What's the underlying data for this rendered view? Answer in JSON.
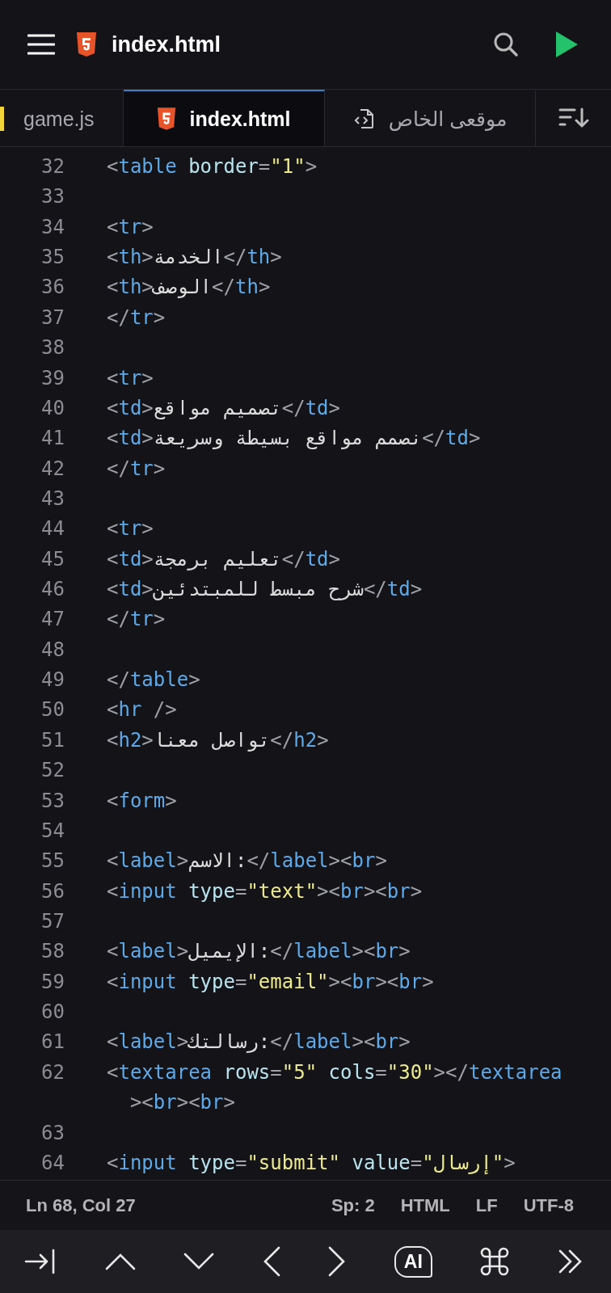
{
  "header": {
    "title": "index.html"
  },
  "tabs": [
    {
      "label": "game.js",
      "kind": "js",
      "selected": false
    },
    {
      "label": "index.html",
      "kind": "html",
      "selected": true
    },
    {
      "label": "موقعى الخاص",
      "kind": "file",
      "selected": false
    }
  ],
  "lines": [
    {
      "number": "32",
      "tokens": [
        {
          "kind": "punct",
          "text": "<"
        },
        {
          "kind": "tag",
          "text": "table"
        },
        {
          "kind": "attr",
          "text": " border"
        },
        {
          "kind": "punct",
          "text": "="
        },
        {
          "kind": "string",
          "text": "\"1\""
        },
        {
          "kind": "punct",
          "text": ">"
        }
      ]
    },
    {
      "number": "33"
    },
    {
      "number": "34",
      "tokens": [
        {
          "kind": "punct",
          "text": "<"
        },
        {
          "kind": "tag",
          "text": "tr"
        },
        {
          "kind": "punct",
          "text": ">"
        }
      ]
    },
    {
      "number": "35",
      "tokens": [
        {
          "kind": "punct",
          "text": "<"
        },
        {
          "kind": "tag",
          "text": "th"
        },
        {
          "kind": "punct",
          "text": ">"
        },
        {
          "kind": "text",
          "text": "الخدمة"
        },
        {
          "kind": "punct",
          "text": "</"
        },
        {
          "kind": "tag",
          "text": "th"
        },
        {
          "kind": "punct",
          "text": ">"
        }
      ]
    },
    {
      "number": "36",
      "tokens": [
        {
          "kind": "punct",
          "text": "<"
        },
        {
          "kind": "tag",
          "text": "th"
        },
        {
          "kind": "punct",
          "text": ">"
        },
        {
          "kind": "text",
          "text": "الوصف"
        },
        {
          "kind": "punct",
          "text": "</"
        },
        {
          "kind": "tag",
          "text": "th"
        },
        {
          "kind": "punct",
          "text": ">"
        }
      ]
    },
    {
      "number": "37",
      "tokens": [
        {
          "kind": "punct",
          "text": "</"
        },
        {
          "kind": "tag",
          "text": "tr"
        },
        {
          "kind": "punct",
          "text": ">"
        }
      ]
    },
    {
      "number": "38"
    },
    {
      "number": "39",
      "tokens": [
        {
          "kind": "punct",
          "text": "<"
        },
        {
          "kind": "tag",
          "text": "tr"
        },
        {
          "kind": "punct",
          "text": ">"
        }
      ]
    },
    {
      "number": "40",
      "tokens": [
        {
          "kind": "punct",
          "text": "<"
        },
        {
          "kind": "tag",
          "text": "td"
        },
        {
          "kind": "punct",
          "text": ">"
        },
        {
          "kind": "text",
          "text": "تصميم مواقع"
        },
        {
          "kind": "punct",
          "text": "</"
        },
        {
          "kind": "tag",
          "text": "td"
        },
        {
          "kind": "punct",
          "text": ">"
        }
      ]
    },
    {
      "number": "41",
      "tokens": [
        {
          "kind": "punct",
          "text": "<"
        },
        {
          "kind": "tag",
          "text": "td"
        },
        {
          "kind": "punct",
          "text": ">"
        },
        {
          "kind": "text",
          "text": "نصمم مواقع بسيطة وسريعة"
        },
        {
          "kind": "punct",
          "text": "</"
        },
        {
          "kind": "tag",
          "text": "td"
        },
        {
          "kind": "punct",
          "text": ">"
        }
      ]
    },
    {
      "number": "42",
      "tokens": [
        {
          "kind": "punct",
          "text": "</"
        },
        {
          "kind": "tag",
          "text": "tr"
        },
        {
          "kind": "punct",
          "text": ">"
        }
      ]
    },
    {
      "number": "43"
    },
    {
      "number": "44",
      "tokens": [
        {
          "kind": "punct",
          "text": "<"
        },
        {
          "kind": "tag",
          "text": "tr"
        },
        {
          "kind": "punct",
          "text": ">"
        }
      ]
    },
    {
      "number": "45",
      "tokens": [
        {
          "kind": "punct",
          "text": "<"
        },
        {
          "kind": "tag",
          "text": "td"
        },
        {
          "kind": "punct",
          "text": ">"
        },
        {
          "kind": "text",
          "text": "تعليم برمجة"
        },
        {
          "kind": "punct",
          "text": "</"
        },
        {
          "kind": "tag",
          "text": "td"
        },
        {
          "kind": "punct",
          "text": ">"
        }
      ]
    },
    {
      "number": "46",
      "tokens": [
        {
          "kind": "punct",
          "text": "<"
        },
        {
          "kind": "tag",
          "text": "td"
        },
        {
          "kind": "punct",
          "text": ">"
        },
        {
          "kind": "text",
          "text": "شرح مبسط للمبتدئين"
        },
        {
          "kind": "punct",
          "text": "</"
        },
        {
          "kind": "tag",
          "text": "td"
        },
        {
          "kind": "punct",
          "text": ">"
        }
      ]
    },
    {
      "number": "47",
      "tokens": [
        {
          "kind": "punct",
          "text": "</"
        },
        {
          "kind": "tag",
          "text": "tr"
        },
        {
          "kind": "punct",
          "text": ">"
        }
      ]
    },
    {
      "number": "48"
    },
    {
      "number": "49",
      "tokens": [
        {
          "kind": "punct",
          "text": "</"
        },
        {
          "kind": "tag",
          "text": "table"
        },
        {
          "kind": "punct",
          "text": ">"
        }
      ]
    },
    {
      "number": "50",
      "tokens": [
        {
          "kind": "punct",
          "text": "<"
        },
        {
          "kind": "tag",
          "text": "hr"
        },
        {
          "kind": "punct",
          "text": " />"
        }
      ]
    },
    {
      "number": "51",
      "tokens": [
        {
          "kind": "punct",
          "text": "<"
        },
        {
          "kind": "tag",
          "text": "h2"
        },
        {
          "kind": "punct",
          "text": ">"
        },
        {
          "kind": "text",
          "text": "تواصل معنا"
        },
        {
          "kind": "punct",
          "text": "</"
        },
        {
          "kind": "tag",
          "text": "h2"
        },
        {
          "kind": "punct",
          "text": ">"
        }
      ]
    },
    {
      "number": "52"
    },
    {
      "number": "53",
      "tokens": [
        {
          "kind": "punct",
          "text": "<"
        },
        {
          "kind": "tag",
          "text": "form"
        },
        {
          "kind": "punct",
          "text": ">"
        }
      ]
    },
    {
      "number": "54"
    },
    {
      "number": "55",
      "tokens": [
        {
          "kind": "punct",
          "text": "<"
        },
        {
          "kind": "tag",
          "text": "label"
        },
        {
          "kind": "punct",
          "text": ">"
        },
        {
          "kind": "text",
          "text": "الاسم:"
        },
        {
          "kind": "punct",
          "text": "</"
        },
        {
          "kind": "tag",
          "text": "label"
        },
        {
          "kind": "punct",
          "text": "><"
        },
        {
          "kind": "tag",
          "text": "br"
        },
        {
          "kind": "punct",
          "text": ">"
        }
      ]
    },
    {
      "number": "56",
      "tokens": [
        {
          "kind": "punct",
          "text": "<"
        },
        {
          "kind": "tag",
          "text": "input"
        },
        {
          "kind": "attr",
          "text": " type"
        },
        {
          "kind": "punct",
          "text": "="
        },
        {
          "kind": "string",
          "text": "\"text\""
        },
        {
          "kind": "punct",
          "text": "><"
        },
        {
          "kind": "tag",
          "text": "br"
        },
        {
          "kind": "punct",
          "text": "><"
        },
        {
          "kind": "tag",
          "text": "br"
        },
        {
          "kind": "punct",
          "text": ">"
        }
      ]
    },
    {
      "number": "57"
    },
    {
      "number": "58",
      "tokens": [
        {
          "kind": "punct",
          "text": "<"
        },
        {
          "kind": "tag",
          "text": "label"
        },
        {
          "kind": "punct",
          "text": ">"
        },
        {
          "kind": "text",
          "text": "الإيميل:"
        },
        {
          "kind": "punct",
          "text": "</"
        },
        {
          "kind": "tag",
          "text": "label"
        },
        {
          "kind": "punct",
          "text": "><"
        },
        {
          "kind": "tag",
          "text": "br"
        },
        {
          "kind": "punct",
          "text": ">"
        }
      ]
    },
    {
      "number": "59",
      "tokens": [
        {
          "kind": "punct",
          "text": "<"
        },
        {
          "kind": "tag",
          "text": "input"
        },
        {
          "kind": "attr",
          "text": " type"
        },
        {
          "kind": "punct",
          "text": "="
        },
        {
          "kind": "string",
          "text": "\"email\""
        },
        {
          "kind": "punct",
          "text": "><"
        },
        {
          "kind": "tag",
          "text": "br"
        },
        {
          "kind": "punct",
          "text": "><"
        },
        {
          "kind": "tag",
          "text": "br"
        },
        {
          "kind": "punct",
          "text": ">"
        }
      ]
    },
    {
      "number": "60"
    },
    {
      "number": "61",
      "tokens": [
        {
          "kind": "punct",
          "text": "<"
        },
        {
          "kind": "tag",
          "text": "label"
        },
        {
          "kind": "punct",
          "text": ">"
        },
        {
          "kind": "text",
          "text": "رسالتك:"
        },
        {
          "kind": "punct",
          "text": "</"
        },
        {
          "kind": "tag",
          "text": "label"
        },
        {
          "kind": "punct",
          "text": "><"
        },
        {
          "kind": "tag",
          "text": "br"
        },
        {
          "kind": "punct",
          "text": ">"
        }
      ]
    },
    {
      "number": "62",
      "tokens": [
        {
          "kind": "punct",
          "text": "<"
        },
        {
          "kind": "tag",
          "text": "textarea"
        },
        {
          "kind": "attr",
          "text": " rows"
        },
        {
          "kind": "punct",
          "text": "="
        },
        {
          "kind": "string",
          "text": "\"5\""
        },
        {
          "kind": "attr",
          "text": " cols"
        },
        {
          "kind": "punct",
          "text": "="
        },
        {
          "kind": "string",
          "text": "\"30\""
        },
        {
          "kind": "punct",
          "text": "></"
        },
        {
          "kind": "tag",
          "text": "textarea"
        },
        {
          "kind": "punct",
          "text": "><"
        },
        {
          "kind": "tag",
          "text": "br"
        },
        {
          "kind": "punct",
          "text": "><"
        },
        {
          "kind": "tag",
          "text": "br"
        },
        {
          "kind": "punct",
          "text": ">"
        }
      ]
    },
    {
      "number": "63"
    },
    {
      "number": "64",
      "tokens": [
        {
          "kind": "punct",
          "text": "<"
        },
        {
          "kind": "tag",
          "text": "input"
        },
        {
          "kind": "attr",
          "text": " type"
        },
        {
          "kind": "punct",
          "text": "="
        },
        {
          "kind": "string",
          "text": "\"submit\""
        },
        {
          "kind": "attr",
          "text": " value"
        },
        {
          "kind": "punct",
          "text": "="
        },
        {
          "kind": "string",
          "text": "\"إرسال\""
        },
        {
          "kind": "punct",
          "text": ">"
        }
      ]
    }
  ],
  "status_bar": {
    "position": "Ln 68, Col 27",
    "items": [
      "Sp: 2",
      "HTML",
      "LF",
      "UTF-8"
    ]
  },
  "toolbar": {
    "ai_label": "AI"
  }
}
